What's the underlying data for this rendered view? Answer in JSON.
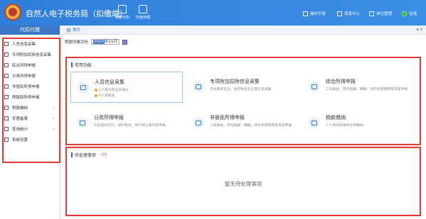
{
  "app": {
    "title": "自然人电子税务局（扣缴端）"
  },
  "toolbar": {
    "left_buttons": [
      {
        "label": "扣缴代扣",
        "icon": "grid-icon"
      },
      {
        "label": "年度申报",
        "icon": "document-icon"
      }
    ],
    "right_tools": [
      {
        "label": "操作手册",
        "icon": "book-icon"
      },
      {
        "label": "消息中心",
        "icon": "mail-icon"
      },
      {
        "label": "单位管理",
        "icon": "building-icon"
      },
      {
        "label": "在线",
        "icon": "online-icon"
      }
    ],
    "online_color": "#46b82c"
  },
  "sidebar": {
    "header": "代扣代缴",
    "items": [
      {
        "label": "人员信息采集",
        "icon": "person-icon",
        "has_chevron": false
      },
      {
        "label": "专项附加扣除信息采集",
        "icon": "list-icon",
        "has_chevron": false
      },
      {
        "label": "综合所得申报",
        "icon": "layers-icon",
        "has_chevron": false
      },
      {
        "label": "分类所得申报",
        "icon": "pie-icon",
        "has_chevron": false
      },
      {
        "label": "非居民所得申报",
        "icon": "user-icon",
        "has_chevron": false
      },
      {
        "label": "限售股所得申报",
        "icon": "chart-icon",
        "has_chevron": false
      },
      {
        "label": "税款缴纳",
        "icon": "coin-icon",
        "has_chevron": true
      },
      {
        "label": "优惠备案",
        "icon": "file-icon",
        "has_chevron": true
      },
      {
        "label": "查询统计",
        "icon": "search-icon",
        "has_chevron": true
      },
      {
        "label": "系统设置",
        "icon": "gear-icon",
        "has_chevron": false
      }
    ]
  },
  "tabs": [
    {
      "label": "首页",
      "icon": "home-icon"
    }
  ],
  "tab_controls": "◂ ×",
  "period": {
    "label": "税款所属月份",
    "year": "2019",
    "month_suffix": "年11月"
  },
  "common_functions": {
    "title": "常用功能",
    "cards": [
      {
        "title": "人员信息采集",
        "lines": [
          "2人身份验证未通过",
          "0人未报送"
        ],
        "subtitle": ""
      },
      {
        "title": "专项附加扣除信息采集",
        "subtitle": "子女教育支出、住房租金支出等信息采集",
        "lines": []
      },
      {
        "title": "综合所得申报",
        "subtitle": "工资薪金、劳务报酬、稿酬、特许权使用费等月度申报",
        "lines": []
      },
      {
        "title": "分类所得申报",
        "subtitle": "利息股息红利、财产租赁、财产转让等月度申报",
        "lines": []
      },
      {
        "title": "非居民所得申报",
        "subtitle": "工资薪金、劳务报酬、稿酬、特许权使用费等月度申报",
        "lines": []
      },
      {
        "title": "税款缴纳",
        "subtitle": "个人所得税税款在线缴纳",
        "lines": []
      }
    ]
  },
  "pending": {
    "title": "待处理事项",
    "count": "(0)",
    "empty_text": "暂无待处理事项"
  },
  "colors": {
    "accent": "#2f7fda",
    "highlight_border": "#e53935"
  }
}
